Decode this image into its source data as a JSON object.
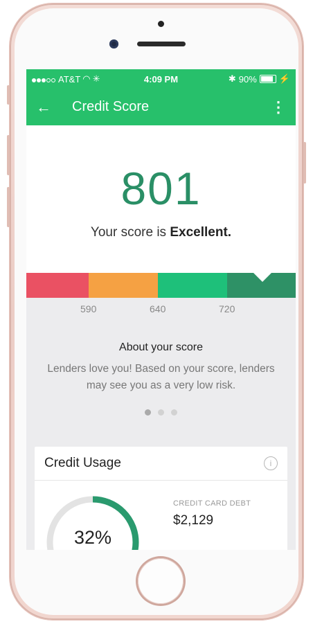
{
  "status_bar": {
    "carrier": "AT&T",
    "time": "4:09 PM",
    "battery_pct": "90%"
  },
  "app_bar": {
    "title": "Credit Score"
  },
  "score": {
    "value": "801",
    "rating_prefix": "Your score is",
    "rating": "Excellent."
  },
  "scale": {
    "ticks": [
      "590",
      "640",
      "720"
    ],
    "colors": [
      "#ea5163",
      "#f5a143",
      "#1ec07a",
      "#2e9166"
    ],
    "current_score": 801
  },
  "about": {
    "title": "About your score",
    "text": "Lenders love you! Based on your score, lenders may see you as a very low risk."
  },
  "pager": {
    "pages": 3,
    "active": 0
  },
  "credit_usage": {
    "title": "Credit Usage",
    "percent": "32%",
    "percent_value": 0.32,
    "debt_label": "CREDIT CARD DEBT",
    "debt_value": "$2,129"
  },
  "colors": {
    "brand_green": "#27c06b",
    "score_green": "#2a8f66"
  }
}
